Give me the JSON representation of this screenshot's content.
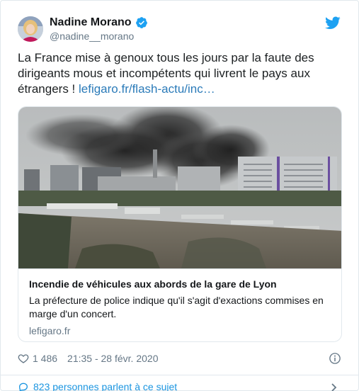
{
  "author": {
    "display_name": "Nadine Morano",
    "handle": "@nadine__morano"
  },
  "tweet": {
    "text": "La France mise à genoux tous les jours par la faute des dirigeants mous et incompétents qui livrent le pays aux étrangers ! ",
    "link": "lefigaro.fr/flash-actu/inc…"
  },
  "card": {
    "title": "Incendie de véhicules aux abords de la gare de Lyon",
    "description": "La préfecture de police indique qu'il s'agit d'exactions commises en marge d'un concert.",
    "domain": "lefigaro.fr",
    "image_icon": "photo-fire-smoke-over-paris-river"
  },
  "meta": {
    "likes": "1 486",
    "timestamp": "21:35 - 28 févr. 2020"
  },
  "conversation": {
    "label": "823 personnes parlent à ce sujet"
  },
  "colors": {
    "link": "#2b7bb9",
    "twitter_blue": "#1da1f2",
    "secondary_text": "#657786",
    "border": "#e1e8ed"
  }
}
